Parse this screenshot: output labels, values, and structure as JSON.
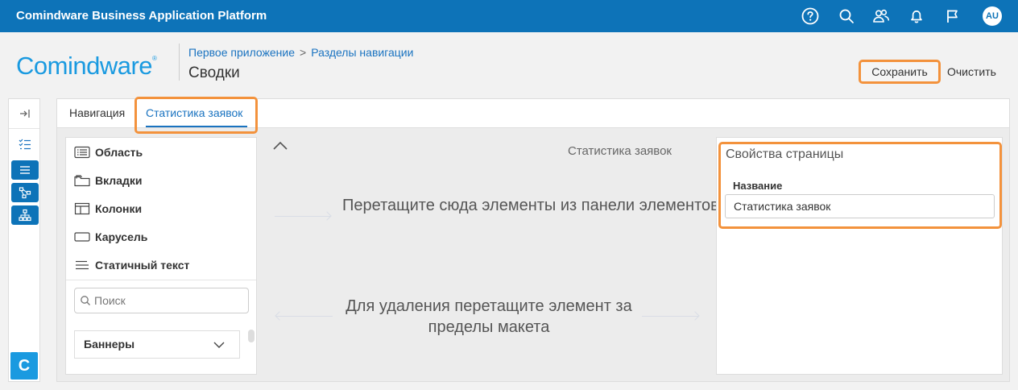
{
  "app": {
    "title": "Comindware Business Application Platform"
  },
  "topbar": {
    "icons": [
      "help-icon",
      "search-icon",
      "users-icon",
      "bell-icon",
      "flag-icon"
    ],
    "avatar": "AU"
  },
  "header": {
    "logo": "Comindware",
    "logo_mark": "®",
    "breadcrumb": [
      "Первое приложение",
      "Разделы навигации"
    ],
    "breadcrumb_separator": ">",
    "page_title": "Сводки",
    "save_label": "Сохранить",
    "clear_label": "Очистить"
  },
  "rail": {
    "icons": [
      "expand-icon",
      "checklist-icon",
      "list-icon",
      "workflow-icon",
      "hierarchy-icon"
    ],
    "brand_letter": "C"
  },
  "tabs": [
    {
      "label": "Навигация",
      "active": false
    },
    {
      "label": "Статистика заявок",
      "active": true
    }
  ],
  "palette": {
    "items": [
      {
        "label": "Область",
        "icon": "area-icon"
      },
      {
        "label": "Вкладки",
        "icon": "tabs-icon"
      },
      {
        "label": "Колонки",
        "icon": "columns-icon"
      },
      {
        "label": "Карусель",
        "icon": "carousel-icon"
      },
      {
        "label": "Статичный текст",
        "icon": "static-text-icon"
      }
    ],
    "search_placeholder": "Поиск",
    "group_label": "Баннеры"
  },
  "canvas": {
    "title": "Статистика заявок",
    "drop_hint": "Перетащите сюда элементы из панели элементов",
    "delete_hint": "Для удаления перетащите элемент за пределы макета"
  },
  "properties": {
    "title": "Свойства страницы",
    "name_label": "Название",
    "name_value": "Статистика заявок"
  },
  "colors": {
    "brand_blue": "#0d73b8",
    "link_blue": "#1a73c0",
    "highlight_orange": "#f3923c"
  }
}
